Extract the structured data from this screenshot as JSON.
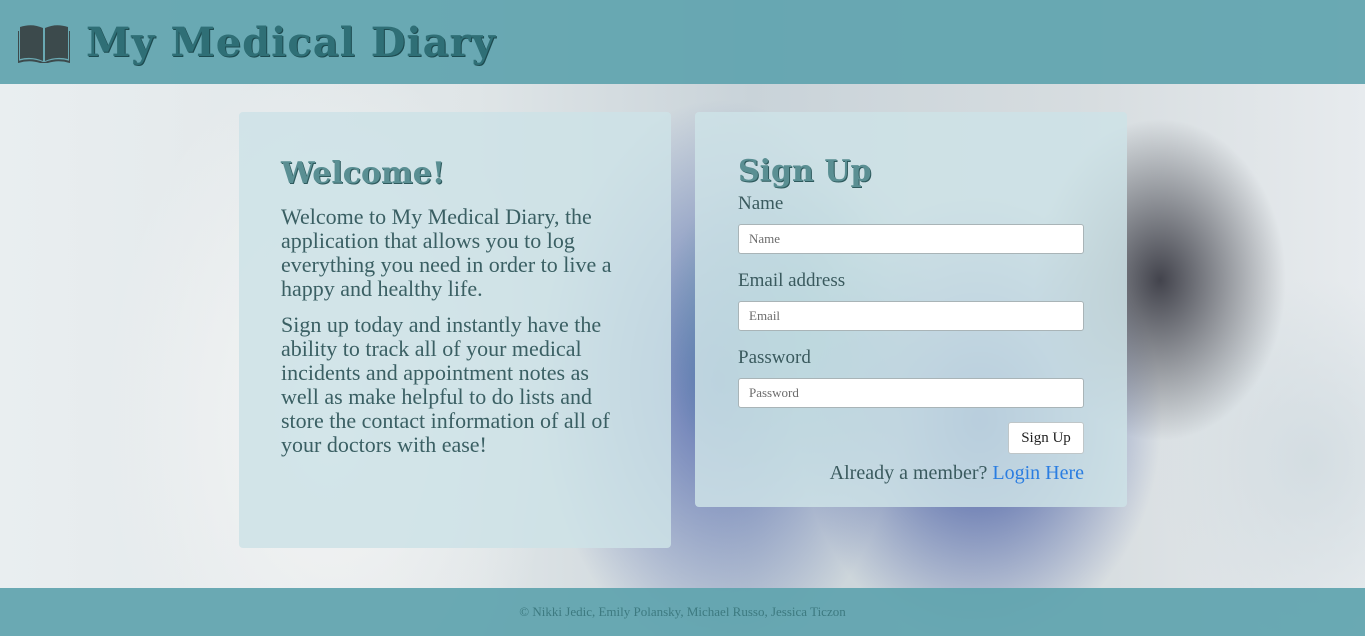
{
  "header": {
    "title": "My Medical Diary",
    "icon": "book-icon"
  },
  "welcome": {
    "heading": "Welcome!",
    "paragraph1": "Welcome to My Medical Diary, the application that allows you to log everything you need in order to live a happy and healthy life.",
    "paragraph2": "Sign up today and instantly have the ability to track all of your medical incidents and appointment notes as well as make helpful to do lists and store the contact information of all of your doctors with ease!"
  },
  "signup": {
    "heading": "Sign Up",
    "name_label": "Name",
    "name_placeholder": "Name",
    "email_label": "Email address",
    "email_placeholder": "Email",
    "password_label": "Password",
    "password_placeholder": "Password",
    "button_label": "Sign Up",
    "member_text": "Already a member?",
    "login_link": "Login Here"
  },
  "footer": {
    "credits": "© Nikki Jedic, Emily Polansky, Michael Russo, Jessica Ticzon"
  },
  "colors": {
    "bar": "#60a4ae",
    "link": "#2a7de1",
    "title": "#2f6f76"
  }
}
